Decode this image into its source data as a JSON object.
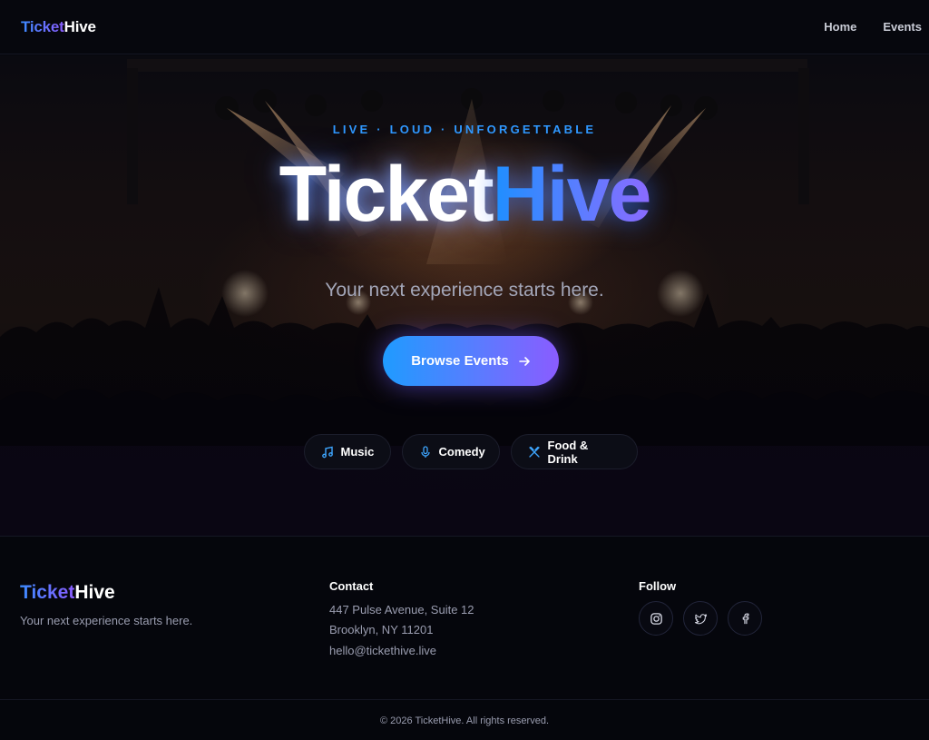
{
  "header": {
    "logo_part1": "Ticket",
    "logo_part2": "Hive",
    "nav": [
      {
        "label": "Home"
      },
      {
        "label": "Events"
      }
    ]
  },
  "hero": {
    "tagline": "LIVE · LOUD · UNFORGETTABLE",
    "title_part1": "Ticket",
    "title_part2": "Hive",
    "subtitle": "Your next experience starts here.",
    "cta_label": "Browse Events",
    "categories": [
      {
        "label": "Music",
        "icon": "music-note-icon"
      },
      {
        "label": "Comedy",
        "icon": "microphone-icon"
      },
      {
        "label": "Food & Drink",
        "icon": "utensils-icon"
      }
    ]
  },
  "footer": {
    "logo_part1": "Ticket",
    "logo_part2": "Hive",
    "tagline": "Your next experience starts here.",
    "contact_title": "Contact",
    "contact_lines": [
      "447 Pulse Avenue, Suite 12",
      "Brooklyn, NY 11201",
      "hello@tickethive.live"
    ],
    "follow_title": "Follow",
    "socials": [
      "instagram-icon",
      "twitter-icon",
      "facebook-icon"
    ],
    "copyright": "© 2026 TicketHive. All rights reserved."
  },
  "colors": {
    "accent_blue": "#1f9bff",
    "accent_purple": "#8a5cff",
    "background": "#05060c"
  }
}
